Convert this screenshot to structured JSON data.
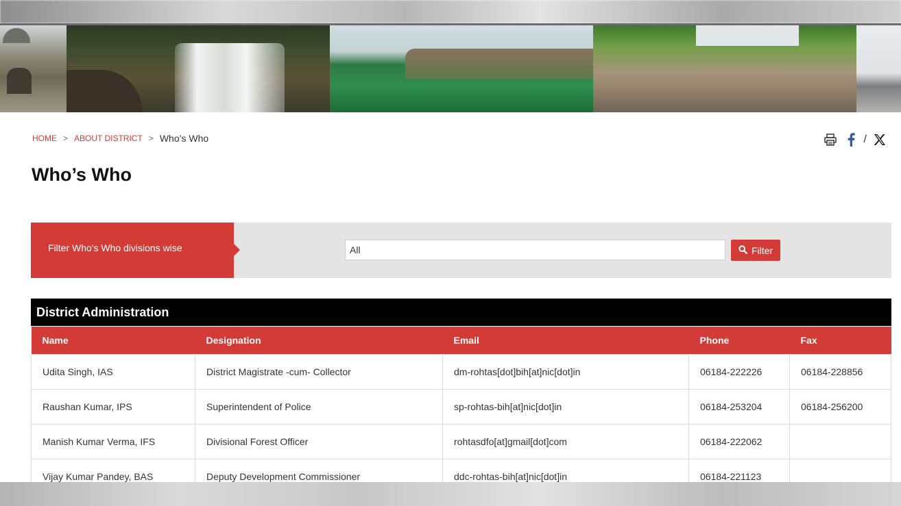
{
  "breadcrumb": {
    "home": "HOME",
    "about": "ABOUT DISTRICT",
    "current": "Who’s Who",
    "separator": ">"
  },
  "share": {
    "icons": [
      "print-icon",
      "facebook-icon",
      "x-twitter-icon"
    ],
    "separator": "/"
  },
  "page": {
    "title": "Who’s Who"
  },
  "filter": {
    "label": "Filter Who's Who divisions wise",
    "value": "All",
    "button_label": "Filter",
    "button_icon": "search-icon"
  },
  "section": {
    "title": "District Administration"
  },
  "table": {
    "headers": [
      "Name",
      "Designation",
      "Email",
      "Phone",
      "Fax"
    ],
    "rows": [
      [
        "Udita Singh, IAS",
        "District Magistrate -cum- Collector",
        "dm-rohtas[dot]bih[at]nic[dot]in",
        "06184-222226",
        "06184-228856"
      ],
      [
        "Raushan Kumar, IPS",
        "Superintendent of Police",
        "sp-rohtas-bih[at]nic[dot]in",
        "06184-253204",
        "06184-256200"
      ],
      [
        "Manish Kumar Verma, IFS",
        "Divisional Forest Officer",
        "rohtasdfo[at]gmail[dot]com",
        "06184-222062",
        ""
      ],
      [
        "Vijay Kumar Pandey, BAS",
        "Deputy Development Commissioner",
        "ddc-rohtas-bih[at]nic[dot]in",
        "06184-221123",
        ""
      ]
    ]
  },
  "colors": {
    "accent": "#d23b36",
    "section_header": "#000000",
    "filter_bar": "#e4e4e4"
  }
}
